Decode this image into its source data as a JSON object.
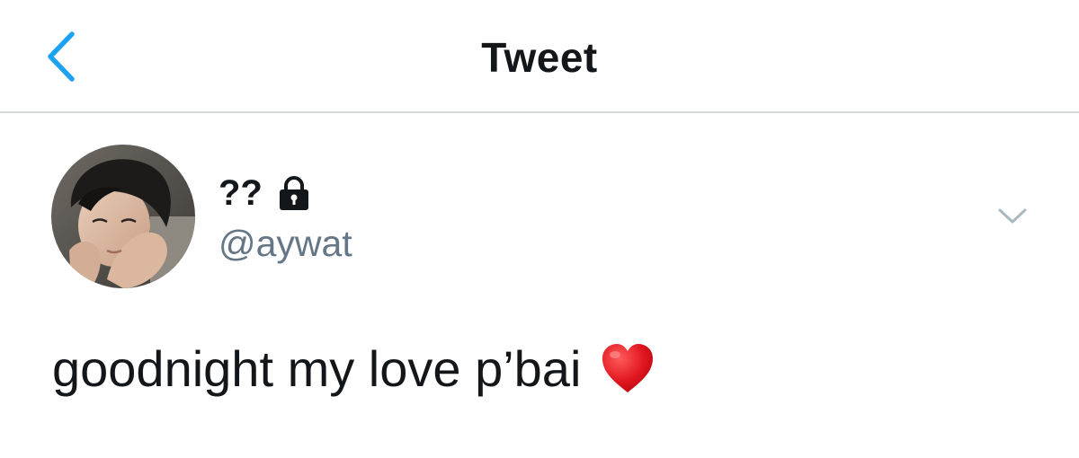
{
  "nav": {
    "back_icon": "chevron-left-icon",
    "title": "Tweet",
    "accent_color": "#1da1f2"
  },
  "tweet": {
    "author": {
      "display_name": "??",
      "handle": "@aywat",
      "protected_icon": "lock-icon",
      "avatar": "profile-photo"
    },
    "more_icon": "chevron-down-icon",
    "text": "goodnight my love p’bai",
    "emoji": "red-heart-icon"
  }
}
